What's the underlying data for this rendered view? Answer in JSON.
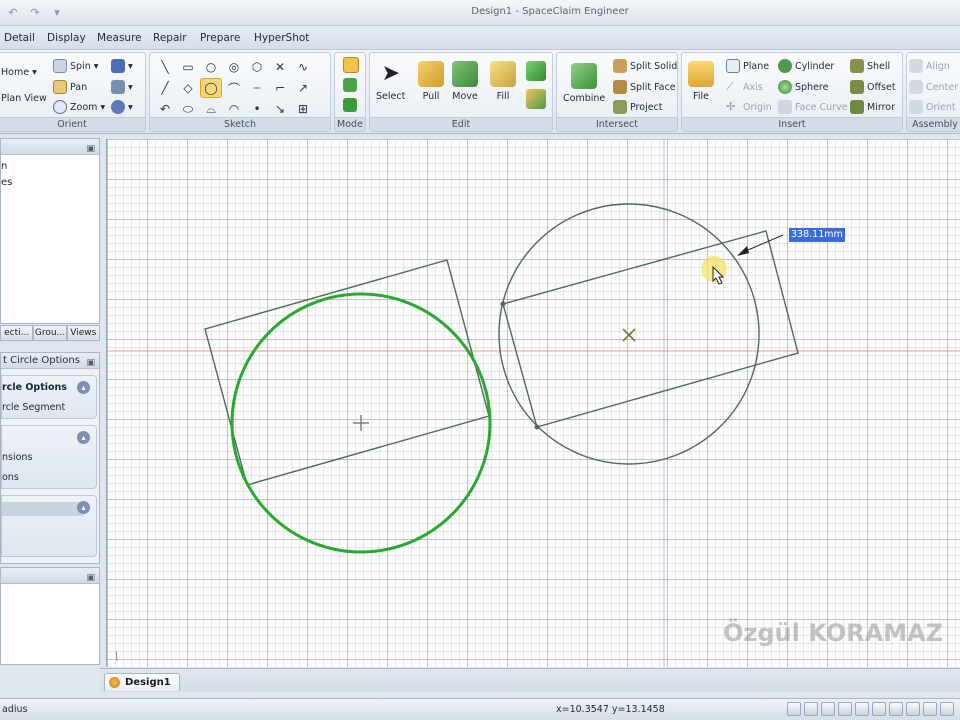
{
  "window": {
    "title": "Design1 - SpaceClaim Engineer"
  },
  "menu": {
    "tabs": [
      "Detail",
      "Display",
      "Measure",
      "Repair",
      "Prepare",
      "HyperShot"
    ]
  },
  "ribbon": {
    "orient": {
      "label": "Orient",
      "home": "Home",
      "plan_view": "Plan View",
      "spin": "Spin",
      "pan": "Pan",
      "zoom": "Zoom"
    },
    "sketch": {
      "label": "Sketch"
    },
    "mode": {
      "label": "Mode"
    },
    "edit": {
      "label": "Edit",
      "select": "Select",
      "pull": "Pull",
      "move": "Move",
      "fill": "Fill"
    },
    "intersect": {
      "label": "Intersect",
      "combine": "Combine",
      "split_solid": "Split Solid",
      "split_face": "Split Face",
      "project": "Project"
    },
    "insert": {
      "label": "Insert",
      "file": "File",
      "plane": "Plane",
      "axis": "Axis",
      "origin": "Origin",
      "cylinder": "Cylinder",
      "sphere": "Sphere",
      "face_curve": "Face Curve",
      "shell": "Shell",
      "offset": "Offset",
      "mirror": "Mirror"
    },
    "assembly": {
      "label": "Assembly",
      "align": "Align",
      "center": "Center",
      "orient": "Orient"
    }
  },
  "tree": {
    "line1": "n",
    "line2": "es"
  },
  "panel_tabs": [
    "ecti...",
    "Grou...",
    "Views"
  ],
  "options": {
    "header": "t Circle Options",
    "title": "rcle Options",
    "segment": "rcle Segment",
    "dimensions": "nsions",
    "ons": "ons"
  },
  "canvas": {
    "dimension": "338.11mm",
    "watermark": "Özgül KORAMAZ"
  },
  "doc_tab": "Design1",
  "status": {
    "left": "adius",
    "coords": "x=10.3547  y=13.1458"
  },
  "colors": {
    "selected_circle": "#2aa832",
    "sketch_line": "#4f6a56",
    "dimension_bg": "#3c6bd8",
    "axis_red": "#e58a8a"
  }
}
